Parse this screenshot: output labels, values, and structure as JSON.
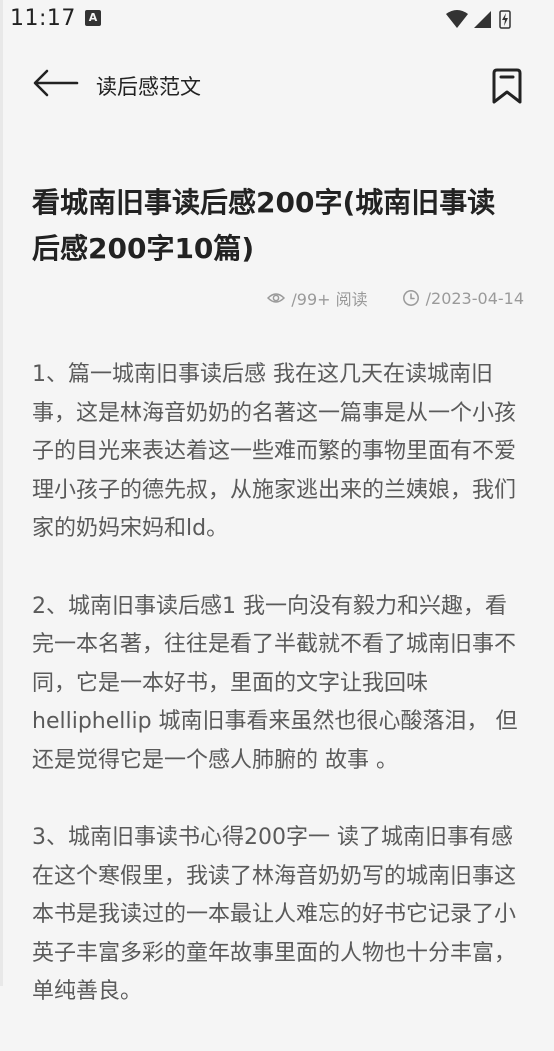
{
  "status_bar": {
    "time": "11:17",
    "notification_letter": "A"
  },
  "header": {
    "title": "读后感范文",
    "back_icon": "arrow-left-icon",
    "bookmark_icon": "bookmark-icon"
  },
  "article": {
    "title": "看城南旧事读后感200字(城南旧事读后感200字10篇)",
    "views": "/99+ 阅读",
    "date": "/2023-04-14",
    "paragraphs": [
      "1、篇一城南旧事读后感 我在这几天在读城南旧事，这是林海音奶奶的名著这一篇事是从一个小孩子的目光来表达着这一些难而繁的事物里面有不爱理小孩子的德先叔，从施家逃出来的兰姨娘，我们家的奶妈宋妈和ld。",
      "2、城南旧事读后感1 我一向没有毅力和兴趣，看完一本名著，往往是看了半截就不看了城南旧事不同，它是一本好书，里面的文字让我回味helliphellip 城南旧事看来虽然也很心酸落泪， 但还是觉得它是一个感人肺腑的 故事 。",
      "3、城南旧事读书心得200字一 读了城南旧事有感在这个寒假里，我读了林海音奶奶写的城南旧事这本书是我读过的一本最让人难忘的好书它记录了小英子丰富多彩的童年故事里面的人物也十分丰富，单纯善良。"
    ]
  },
  "colors": {
    "background": "#f5f5f5",
    "text_primary": "#222222",
    "text_body": "#5a5a5a",
    "text_meta": "#9a9a9a"
  }
}
